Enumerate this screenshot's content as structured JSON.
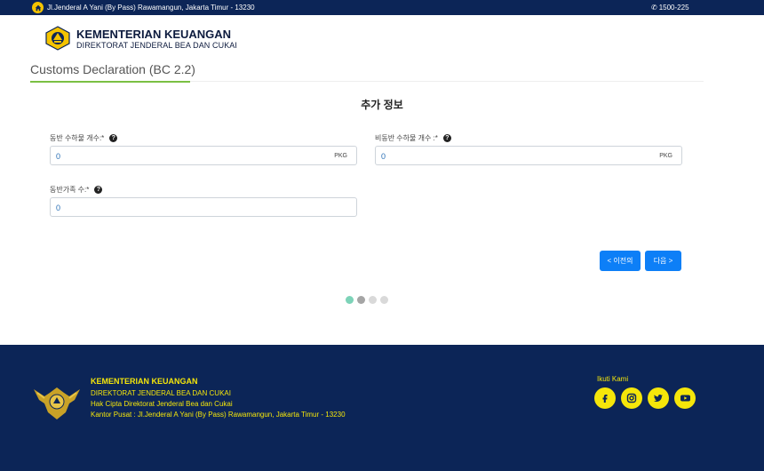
{
  "topbar": {
    "address": "Jl.Jenderal A Yani (By Pass) Rawamangun, Jakarta Timur - 13230",
    "phone": "1500-225"
  },
  "brand": {
    "title": "KEMENTERIAN KEUANGAN",
    "subtitle": "DIREKTORAT JENDERAL BEA DAN CUKAI"
  },
  "page": {
    "title": "Customs Declaration (BC 2.2)",
    "section_title": "추가 정보"
  },
  "form": {
    "accompanied_count": {
      "label": "동반 수하물 개수:*",
      "value": "0",
      "unit": "PKG"
    },
    "unaccompanied_count": {
      "label": "비동반 수하물 개수 :*",
      "value": "0",
      "unit": "PKG"
    },
    "family_count": {
      "label": "동반가족 수:*",
      "value": "0"
    }
  },
  "buttons": {
    "prev": "< 이전의",
    "next": "다음 >"
  },
  "progress": {
    "total_steps": 4,
    "completed_steps": 1,
    "current_step": 2
  },
  "footer": {
    "org": "KEMENTERIAN KEUANGAN",
    "dept": "DIREKTORAT JENDERAL BEA DAN CUKAI",
    "copyright": "Hak Cipta Direktorat Jenderal Bea dan Cukai",
    "office": "Kantor Pusat : Jl.Jenderal A Yani (By Pass) Rawamangun, Jakarta Timur - 13230",
    "follow_label": "Ikuti Kami",
    "socials": [
      "facebook-icon",
      "instagram-icon",
      "twitter-icon",
      "youtube-icon"
    ]
  },
  "colors": {
    "navy": "#0c2557",
    "yellow": "#f5e60a",
    "primary": "#0d7ff7",
    "green": "#7bc043",
    "step_done": "#7dd3b8",
    "step_current": "#a5a5a5",
    "step_pending": "#d9d9d9"
  }
}
